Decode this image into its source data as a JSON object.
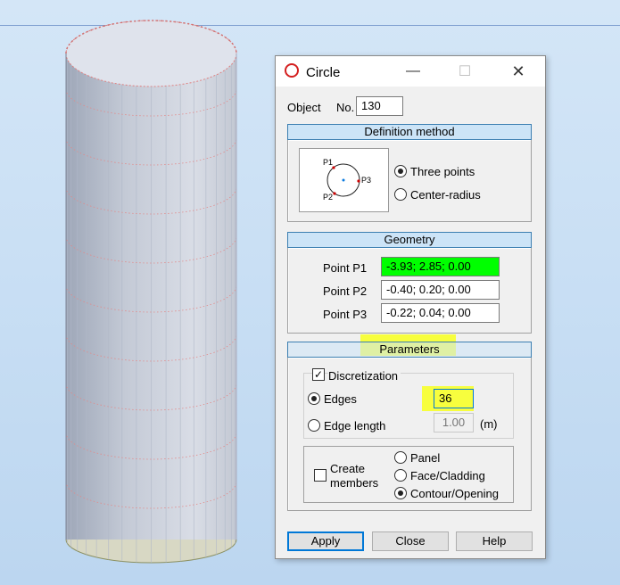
{
  "dialog": {
    "title": "Circle",
    "object_label": "Object",
    "no_label": "No.",
    "object_no": "130",
    "definition_header": "Definition method",
    "diagram_labels": {
      "p1": "P1",
      "p2": "P2",
      "p3": "P3"
    },
    "methods": [
      {
        "label": "Three points",
        "selected": true
      },
      {
        "label": "Center-radius",
        "selected": false
      }
    ],
    "geometry_header": "Geometry",
    "points": [
      {
        "label": "Point P1",
        "value": "-3.93; 2.85; 0.00",
        "highlight": "#00ff00"
      },
      {
        "label": "Point P2",
        "value": "-0.40; 0.20; 0.00"
      },
      {
        "label": "Point P3",
        "value": "-0.22; 0.04; 0.00"
      }
    ],
    "parameters_header": "Parameters",
    "discretization_label": "Discretization",
    "discretization_checked": true,
    "edges_label": "Edges",
    "edges_value": "36",
    "edge_length_label": "Edge length",
    "edge_length_value": "1.00",
    "edge_length_unit": "(m)",
    "create_members_label_1": "Create",
    "create_members_label_2": "members",
    "member_types": [
      {
        "label": "Panel",
        "selected": false
      },
      {
        "label": "Face/Cladding",
        "selected": false
      },
      {
        "label": "Contour/Opening",
        "selected": true
      }
    ],
    "buttons": {
      "apply": "Apply",
      "close": "Close",
      "help": "Help"
    }
  },
  "colors": {
    "accent": "#0078d7",
    "header_fill": "#cce4f7",
    "highlight": "#f7ff2a",
    "p1_field": "#00ff00"
  }
}
